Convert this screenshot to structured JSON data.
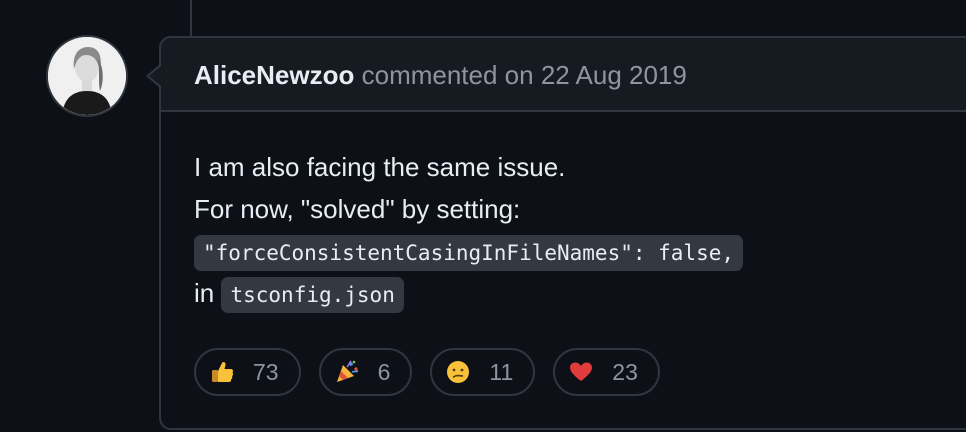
{
  "comment": {
    "author": "AliceNewzoo",
    "meta": "commented on 22 Aug 2019",
    "body": {
      "line1": "I am also facing the same issue.",
      "line2": "For now, \"solved\" by setting:",
      "code1": "\"forceConsistentCasingInFileNames\": false,",
      "line4_prefix": "in",
      "code2": "tsconfig.json"
    }
  },
  "reactions": [
    {
      "icon": "thumbs-up-icon",
      "count": "73"
    },
    {
      "icon": "party-popper-icon",
      "count": "6"
    },
    {
      "icon": "confused-face-icon",
      "count": "11"
    },
    {
      "icon": "red-heart-icon",
      "count": "23"
    }
  ],
  "colors": {
    "background": "#0d1117",
    "header_bg": "#161b22",
    "border": "#30363d",
    "text": "#e6edf3",
    "muted": "#8d96a0",
    "code_bg": "#343941"
  }
}
